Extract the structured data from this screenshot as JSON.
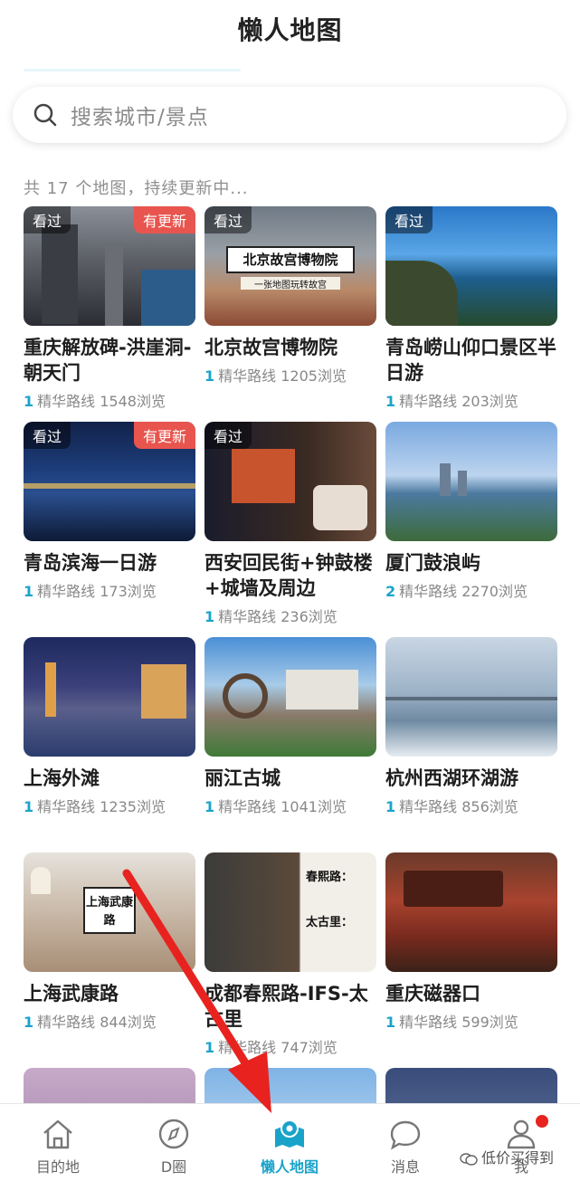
{
  "header": {
    "title": "懒人地图"
  },
  "search": {
    "placeholder": "搜索城市/景点"
  },
  "subtitle": "共 17 个地图，持续更新中...",
  "badges": {
    "seen": "看过",
    "new": "有更新"
  },
  "route_label": "精华路线",
  "cards": [
    {
      "name": "重庆解放碑-洪崖洞-朝天门",
      "routes": "1",
      "views": "1548浏览"
    },
    {
      "name": "北京故宫博物院",
      "routes": "1",
      "views": "1205浏览",
      "thumb_text": "北京故宫博物院",
      "thumb_sub": "一张地图玩转故宫"
    },
    {
      "name": "青岛崂山仰口景区半日游",
      "routes": "1",
      "views": "203浏览"
    },
    {
      "name": "青岛滨海一日游",
      "routes": "1",
      "views": "173浏览"
    },
    {
      "name": "西安回民街+钟鼓楼+城墙及周边",
      "routes": "1",
      "views": "236浏览"
    },
    {
      "name": "厦门鼓浪屿",
      "routes": "2",
      "views": "2270浏览"
    },
    {
      "name": "上海外滩",
      "routes": "1",
      "views": "1235浏览"
    },
    {
      "name": "丽江古城",
      "routes": "1",
      "views": "1041浏览"
    },
    {
      "name": "杭州西湖环湖游",
      "routes": "1",
      "views": "856浏览"
    },
    {
      "name": "上海武康路",
      "routes": "1",
      "views": "844浏览",
      "thumb_text": "上海武康路"
    },
    {
      "name": "成都春熙路-IFS-太古里",
      "routes": "1",
      "views": "747浏览",
      "thumb_text": "春熙路：",
      "thumb_text2": "太古里："
    },
    {
      "name": "重庆磁器口",
      "routes": "1",
      "views": "599浏览"
    }
  ],
  "tabs": [
    {
      "label": "目的地",
      "icon": "home-icon"
    },
    {
      "label": "D圈",
      "icon": "compass-icon"
    },
    {
      "label": "懒人地图",
      "icon": "map-pin-icon"
    },
    {
      "label": "消息",
      "icon": "chat-icon"
    },
    {
      "label": "我",
      "icon": "user-icon"
    }
  ],
  "watermark": "低价买得到",
  "colors": {
    "accent": "#1aa3c9",
    "badge_new": "#e8554e",
    "arrow": "#e8231f"
  }
}
